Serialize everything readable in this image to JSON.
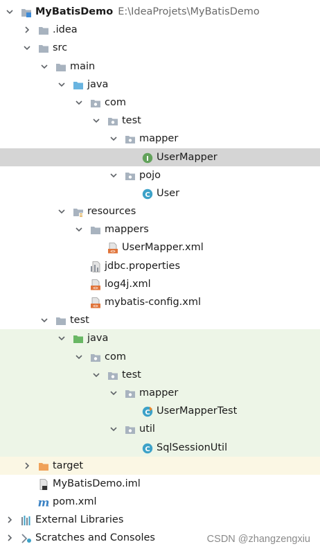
{
  "tree": [
    {
      "level": 0,
      "expanded": true,
      "icon": "module-icon",
      "name": "MyBatisDemo",
      "path": "E:\\IdeaProjets\\MyBatisDemo",
      "bold": true
    },
    {
      "level": 1,
      "expanded": false,
      "icon": "folder-icon",
      "name": ".idea"
    },
    {
      "level": 1,
      "expanded": true,
      "icon": "folder-icon",
      "name": "src"
    },
    {
      "level": 2,
      "expanded": true,
      "icon": "folder-icon",
      "name": "main"
    },
    {
      "level": 3,
      "expanded": true,
      "icon": "source-folder-icon",
      "name": "java"
    },
    {
      "level": 4,
      "expanded": true,
      "icon": "package-icon",
      "name": "com"
    },
    {
      "level": 5,
      "expanded": true,
      "icon": "package-icon",
      "name": "test"
    },
    {
      "level": 6,
      "expanded": true,
      "icon": "package-icon",
      "name": "mapper"
    },
    {
      "level": 7,
      "icon": "interface-icon",
      "name": "UserMapper",
      "selected": true
    },
    {
      "level": 6,
      "expanded": true,
      "icon": "package-icon",
      "name": "pojo"
    },
    {
      "level": 7,
      "icon": "class-icon",
      "name": "User"
    },
    {
      "level": 3,
      "expanded": true,
      "icon": "resources-folder-icon",
      "name": "resources"
    },
    {
      "level": 4,
      "expanded": true,
      "icon": "folder-icon",
      "name": "mappers"
    },
    {
      "level": 5,
      "icon": "xml-file-icon",
      "name": "UserMapper.xml"
    },
    {
      "level": 4,
      "icon": "properties-file-icon",
      "name": "jdbc.properties"
    },
    {
      "level": 4,
      "icon": "xml-file-icon",
      "name": "log4j.xml"
    },
    {
      "level": 4,
      "icon": "xml-file-icon",
      "name": "mybatis-config.xml"
    },
    {
      "level": 2,
      "expanded": true,
      "icon": "folder-icon",
      "name": "test"
    },
    {
      "level": 3,
      "expanded": true,
      "icon": "test-folder-icon",
      "name": "java",
      "bg": "test"
    },
    {
      "level": 4,
      "expanded": true,
      "icon": "package-icon",
      "name": "com",
      "bg": "test"
    },
    {
      "level": 5,
      "expanded": true,
      "icon": "package-icon",
      "name": "test",
      "bg": "test"
    },
    {
      "level": 6,
      "expanded": true,
      "icon": "package-icon",
      "name": "mapper",
      "bg": "test"
    },
    {
      "level": 7,
      "icon": "test-class-icon",
      "name": "UserMapperTest",
      "bg": "test"
    },
    {
      "level": 6,
      "expanded": true,
      "icon": "package-icon",
      "name": "util",
      "bg": "test"
    },
    {
      "level": 7,
      "icon": "class-icon",
      "name": "SqlSessionUtil",
      "bg": "test"
    },
    {
      "level": 1,
      "expanded": false,
      "icon": "excluded-folder-icon",
      "name": "target",
      "bg": "excluded"
    },
    {
      "level": 1,
      "icon": "iml-file-icon",
      "name": "MyBatisDemo.iml"
    },
    {
      "level": 1,
      "icon": "maven-icon",
      "name": "pom.xml"
    },
    {
      "level": 0,
      "expanded": false,
      "icon": "libraries-icon",
      "name": "External Libraries"
    },
    {
      "level": 0,
      "expanded": false,
      "icon": "scratches-icon",
      "name": "Scratches and Consoles"
    }
  ],
  "watermark": "CSDN @zhangzengxiu",
  "colors": {
    "selection": "#d5d5d5",
    "test_background": "#edf5e7",
    "excluded_background": "#fbf7e4",
    "folder": "#a8b3bf",
    "source_folder": "#69b4e0",
    "test_folder": "#69b764",
    "excluded_folder": "#f0a25a",
    "class": "#3da2c8",
    "interface": "#62a25b",
    "xml": "#e0743a"
  }
}
